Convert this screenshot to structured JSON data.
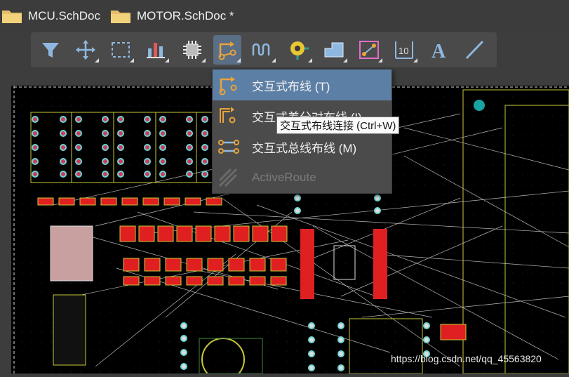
{
  "tabs": [
    {
      "label": "MCU.SchDoc"
    },
    {
      "label": "MOTOR.SchDoc *"
    }
  ],
  "toolbar": {
    "items": [
      {
        "name": "filter"
      },
      {
        "name": "move"
      },
      {
        "name": "select"
      },
      {
        "name": "align"
      },
      {
        "name": "component"
      },
      {
        "name": "interactive-routing"
      },
      {
        "name": "length-tuning"
      },
      {
        "name": "via"
      },
      {
        "name": "polygon"
      },
      {
        "name": "keepout"
      },
      {
        "name": "dimension"
      },
      {
        "name": "string"
      },
      {
        "name": "line"
      }
    ]
  },
  "route_menu": {
    "items": [
      {
        "label": "交互式布线 (T)",
        "highlighted": true,
        "disabled": false
      },
      {
        "label": "交互式差分对布线 (I)",
        "highlighted": false,
        "disabled": false
      },
      {
        "label": "交互式总线布线 (M)",
        "highlighted": false,
        "disabled": false
      },
      {
        "label": "ActiveRoute",
        "highlighted": false,
        "disabled": true
      }
    ]
  },
  "tooltip": {
    "text": "交互式布线连接 (Ctrl+W)"
  },
  "watermark": {
    "text": "https://blog.csdn.net/qq_45563820"
  },
  "colors": {
    "accent": "#5c7fa5",
    "route": "#e8a33b",
    "board": "#000000",
    "copper": "#d9d94a",
    "pad": "#e02020"
  }
}
